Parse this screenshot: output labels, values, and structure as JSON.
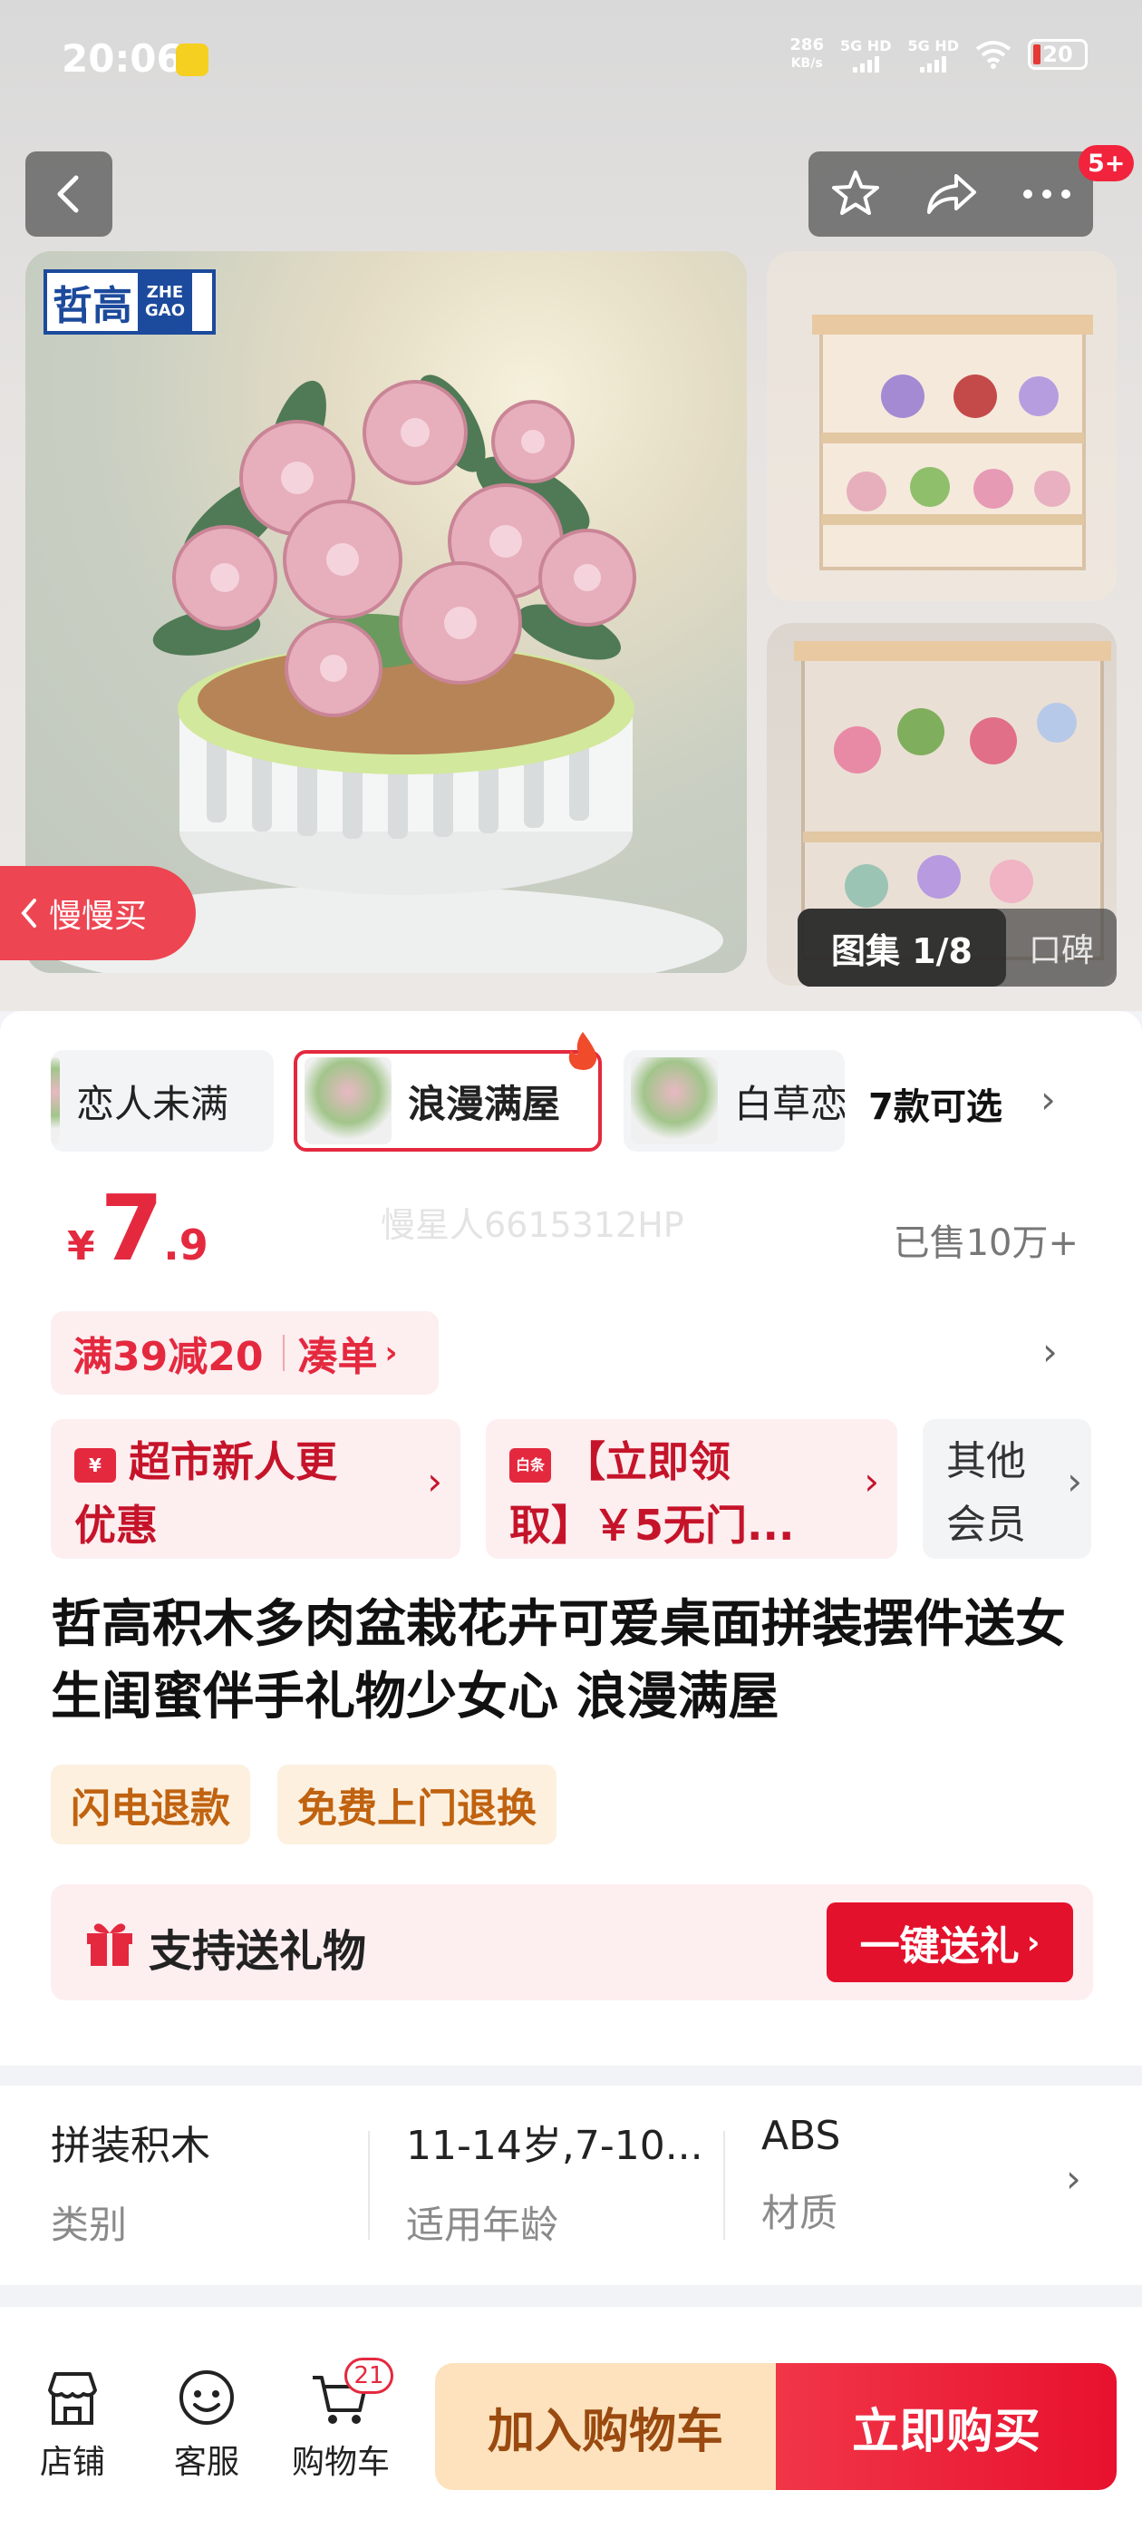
{
  "status_bar": {
    "time": "20:06",
    "net_speed_value": "286",
    "net_speed_unit": "KB/s",
    "sim1": "5G HD",
    "sim2": "5G HD",
    "battery": "20"
  },
  "header": {
    "cart_badge": "5+"
  },
  "gallery": {
    "brand_logo_cn": "哲高",
    "brand_logo_en": "ZHE GAO",
    "slow_buy": "慢慢买",
    "tab_active": "图集 1/8",
    "tab_inactive": "口碑"
  },
  "variants": {
    "items": [
      {
        "label": "恋人未满"
      },
      {
        "label": "浪漫满屋",
        "selected": true
      },
      {
        "label": "白草恋"
      }
    ],
    "more": "7款可选"
  },
  "price": {
    "currency": "¥",
    "integer": "7",
    "decimal": ".9",
    "watermark": "慢星人6615312HP",
    "sold": "已售10万+"
  },
  "coupon": {
    "deal": "满39减20",
    "action": "凑单"
  },
  "promos": [
    {
      "line1": "超市新人更",
      "line2": "优惠",
      "icon_text": "¥"
    },
    {
      "line1": "【立即领",
      "line2": "取】￥5无门...",
      "icon_text": "白条"
    },
    {
      "line1": "其他",
      "line2": "会员"
    }
  ],
  "product": {
    "title": "哲高积木多肉盆栽花卉可爱桌面拼装摆件送女生闺蜜伴手礼物少女心 浪漫满屋"
  },
  "tags": [
    "闪电退款",
    "免费上门退换"
  ],
  "gift": {
    "label": "支持送礼物",
    "button": "一键送礼"
  },
  "specs": [
    {
      "value": "拼装积木",
      "key": "类别"
    },
    {
      "value": "11-14岁,7-10...",
      "key": "适用年龄"
    },
    {
      "value": "ABS",
      "key": "材质"
    }
  ],
  "bottom_bar": {
    "store": "店铺",
    "service": "客服",
    "cart": "购物车",
    "cart_count": "21",
    "add_to_cart": "加入购物车",
    "buy_now": "立即购买"
  },
  "colors": {
    "accent_red": "#e4293f",
    "buy_gradient_end": "#e8112e",
    "add_cart_bg": "#fde2bd",
    "promo_bg": "#fdeef0",
    "tag_bg": "#fdf0df"
  }
}
